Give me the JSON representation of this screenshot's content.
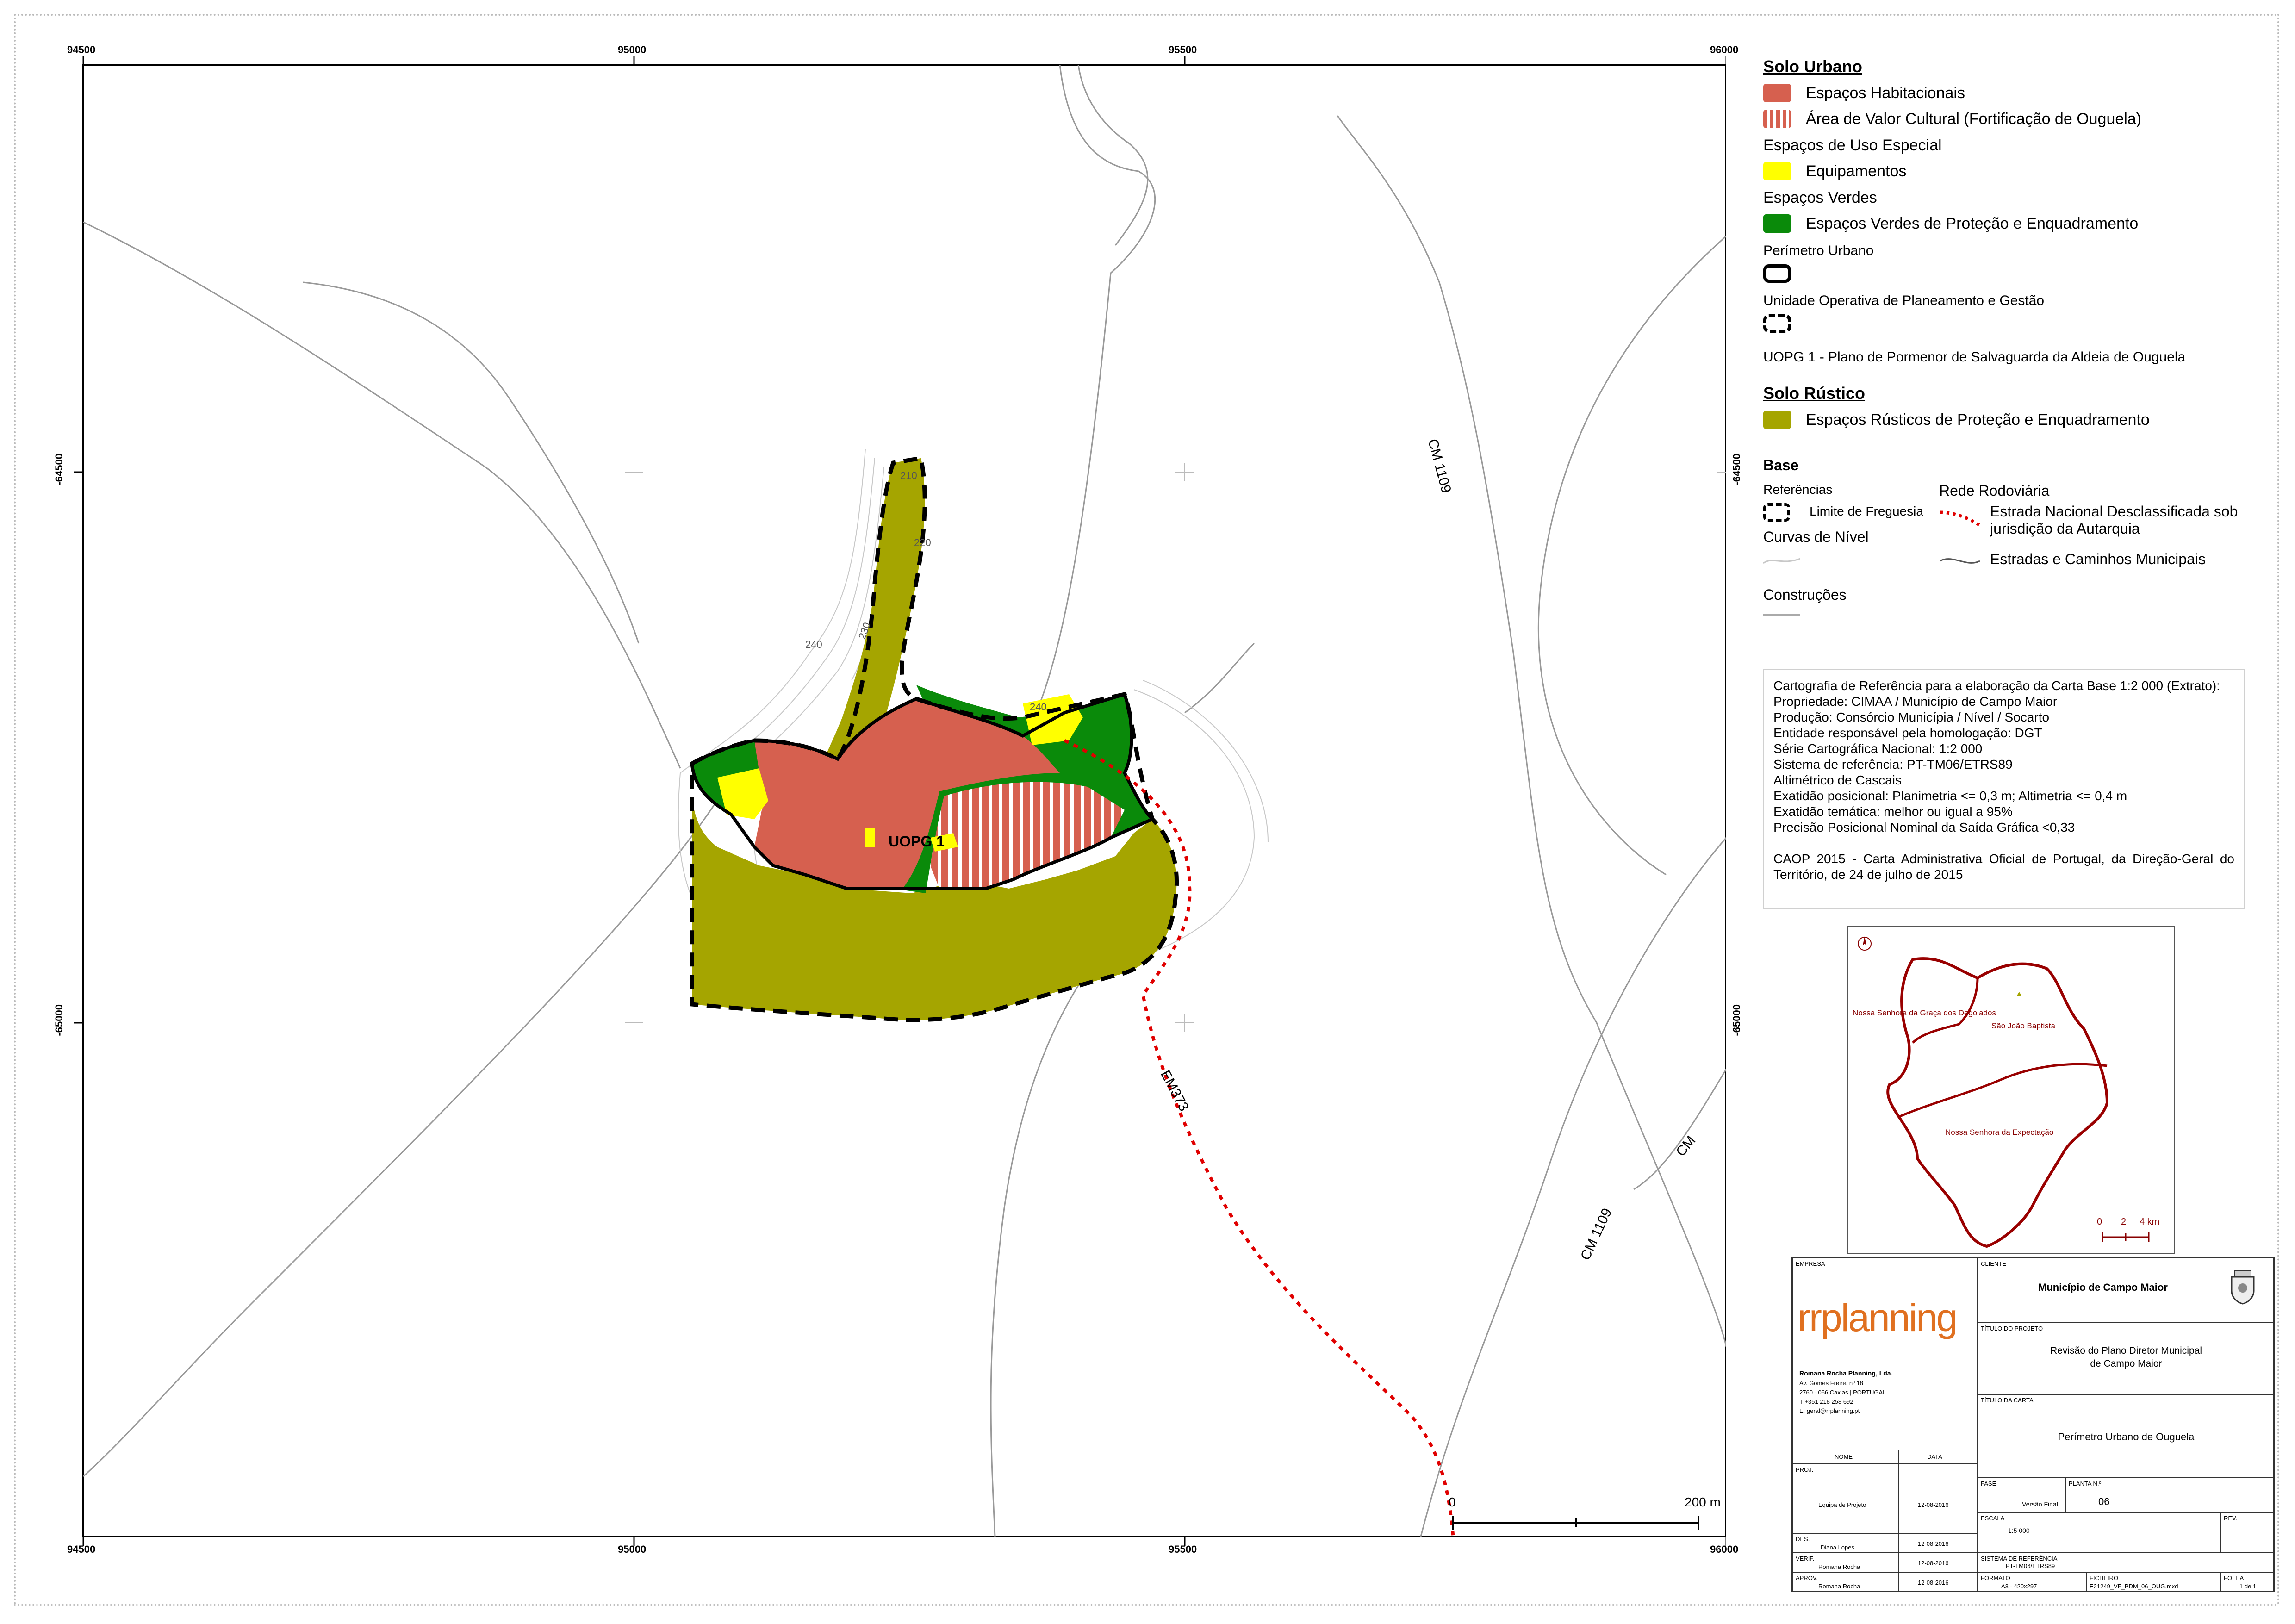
{
  "map": {
    "top_coords": [
      "94500",
      "95000",
      "95500",
      "96000"
    ],
    "bottom_coords": [
      "94500",
      "95000",
      "95500",
      "96000"
    ],
    "left_coords": [
      "-64500",
      "-65000"
    ],
    "right_coords": [
      "-64500",
      "-65000"
    ],
    "road_labels": {
      "cm1109_top": "CM 1109",
      "cm1109_bottom": "CM 1109",
      "cm": "CM",
      "em373": "EM373"
    },
    "contour_labels": {
      "c210": "210",
      "c220": "220",
      "c230": "230",
      "c240a": "240",
      "c240b": "240"
    },
    "uopg_label": "UOPG 1",
    "scale_bar": {
      "start": "0",
      "end": "200 m"
    },
    "colors": {
      "habitacional": "#d6604f",
      "equipamento": "#ffff00",
      "verde": "#0a8a0a",
      "rustico": "#a5a500",
      "road_red": "#e00000"
    }
  },
  "legend": {
    "solo_urbano": "Solo Urbano",
    "espacos_habitacionais": "Espaços Habitacionais",
    "area_valor_cultural": "Área de Valor Cultural (Fortificação de Ouguela)",
    "espacos_uso_especial": "Espaços de Uso Especial",
    "equipamentos": "Equipamentos",
    "espacos_verdes": "Espaços Verdes",
    "espacos_verdes_protecao": "Espaços Verdes de Proteção e Enquadramento",
    "perimetro_urbano": "Perímetro Urbano",
    "unidade_operativa": "Unidade Operativa de Planeamento e Gestão",
    "uopg1": "UOPG 1 - Plano de Pormenor de Salvaguarda da Aldeia de Ouguela",
    "solo_rustico": "Solo Rústico",
    "espacos_rusticos": "Espaços Rústicos de Proteção e Enquadramento",
    "base": "Base",
    "referencias": "Referências",
    "limite_freguesia": "Limite de Freguesia",
    "curvas_nivel": "Curvas de Nível",
    "construcoes": "Construções",
    "rede_rodoviaria": "Rede Rodoviária",
    "estrada_nacional": "Estrada Nacional Desclassificada sob jurisdição da Autarquia",
    "estradas_municipais": "Estradas e Caminhos Municipais"
  },
  "cartography": [
    "Cartografia de Referência para a elaboração da Carta Base 1:2 000 (Extrato):",
    "Propriedade: CIMAA / Município de Campo Maior",
    "Produção: Consórcio Municípia / Nível / Socarto",
    "Entidade responsável pela homologação: DGT",
    "Série Cartográfica Nacional: 1:2 000",
    "Sistema de referência:  PT-TM06/ETRS89",
    "Altimétrico de Cascais",
    "Exatidão posicional: Planimetria <= 0,3 m; Altimetria <= 0,4 m",
    "Exatidão temática: melhor ou igual a 95%",
    "Precisão Posicional Nominal da Saída Gráfica  <0,33",
    "CAOP 2015 - Carta Administrativa Oficial de Portugal, da Direção-Geral do Território, de 24 de julho de 2015"
  ],
  "inset": {
    "label_graca": "Nossa Senhora da Graça dos Degolados",
    "label_joao": "São João Baptista",
    "label_expectacao": "Nossa Senhora da Expectação",
    "scale": [
      "0",
      "2",
      "4 km"
    ]
  },
  "titleblock": {
    "empresa_cap": "EMPRESA",
    "cliente_cap": "CLIENTE",
    "cliente": "Município de Campo Maior",
    "logo_text": "rrplanning",
    "company_name": "Romana Rocha Planning, Lda.",
    "company_addr1": "Av. Gomes Freire, nº 18",
    "company_addr2": "2760 - 066 Caxias | PORTUGAL",
    "company_tel": "T +351 218 258 692",
    "company_email": "E. geral@rrplanning.pt",
    "titulo_projeto_cap": "TÍTULO DO PROJETO",
    "titulo_projeto_1": "Revisão do Plano Diretor Municipal",
    "titulo_projeto_2": "de Campo Maior",
    "titulo_carta_cap": "TÍTULO DA CARTA",
    "titulo_carta": "Perímetro Urbano de Ouguela",
    "nome_cap": "NOME",
    "data_cap": "DATA",
    "proj_cap": "PROJ.",
    "proj_nome": "Equipa de Projeto",
    "proj_data": "12-08-2016",
    "fase_cap": "FASE",
    "fase": "Versão Final",
    "planta_cap": "PLANTA N.º",
    "planta": "06",
    "des_cap": "DES.",
    "des_nome": "Diana Lopes",
    "des_data": "12-08-2016",
    "escala_cap": "ESCALA",
    "escala": "1:5 000",
    "rev_cap": "REV.",
    "verif_cap": "VERIF.",
    "verif_nome": "Romana Rocha",
    "verif_data": "12-08-2016",
    "sistema_cap": "SISTEMA DE REFERÊNCIA",
    "sistema": "PT-TM06/ETRS89",
    "aprov_cap": "APROV.",
    "aprov_nome": "Romana Rocha",
    "aprov_data": "12-08-2016",
    "formato_cap": "FORMATO",
    "formato": "A3 - 420x297",
    "ficheiro_cap": "FICHEIRO",
    "ficheiro": "E21249_VF_PDM_06_OUG.mxd",
    "folha_cap": "FOLHA",
    "folha": "1 de 1"
  }
}
